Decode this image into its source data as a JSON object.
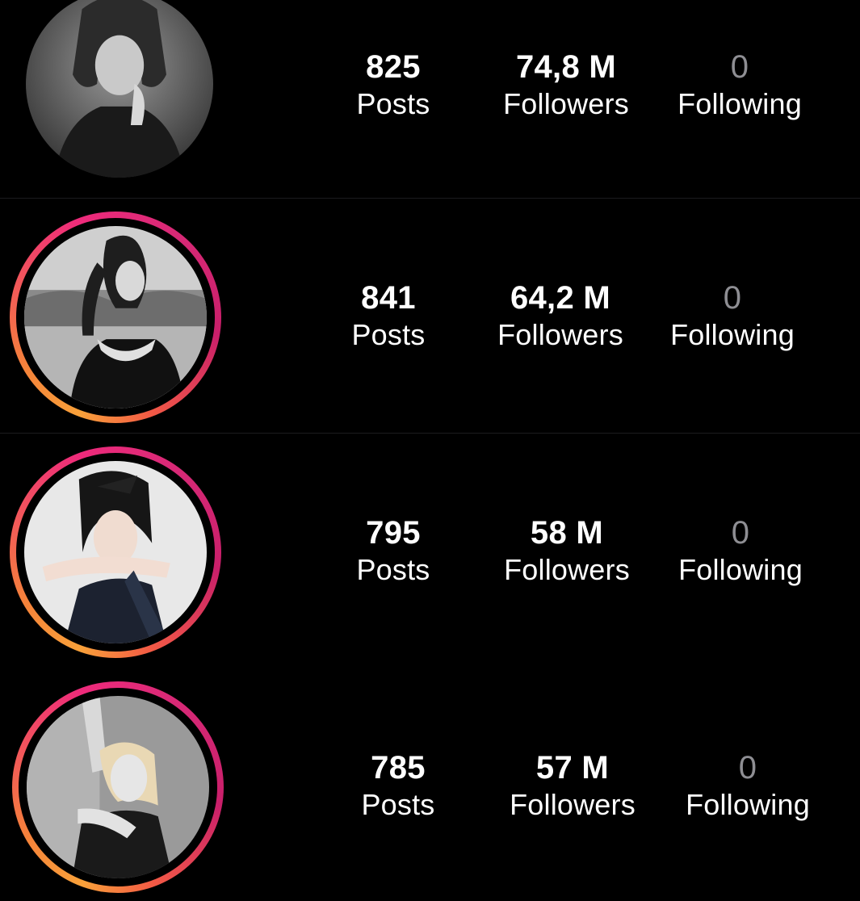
{
  "profiles": [
    {
      "avatar_icon": "profile-photo",
      "has_story_ring": false,
      "posts": "825",
      "posts_label": "Posts",
      "followers": "74,8 M",
      "followers_label": "Followers",
      "following": "0",
      "following_label": "Following"
    },
    {
      "avatar_icon": "profile-photo",
      "has_story_ring": true,
      "posts": "841",
      "posts_label": "Posts",
      "followers": "64,2 M",
      "followers_label": "Followers",
      "following": "0",
      "following_label": "Following"
    },
    {
      "avatar_icon": "profile-photo",
      "has_story_ring": true,
      "posts": "795",
      "posts_label": "Posts",
      "followers": "58 M",
      "followers_label": "Followers",
      "following": "0",
      "following_label": "Following"
    },
    {
      "avatar_icon": "profile-photo",
      "has_story_ring": true,
      "posts": "785",
      "posts_label": "Posts",
      "followers": "57 M",
      "followers_label": "Followers",
      "following": "0",
      "following_label": "Following"
    }
  ],
  "colors": {
    "background": "#000000",
    "text": "#ffffff",
    "muted_text": "#8e8e93",
    "divider": "#1c1c1e",
    "story_ring_start": "#f9a13a",
    "story_ring_end": "#d62976"
  }
}
